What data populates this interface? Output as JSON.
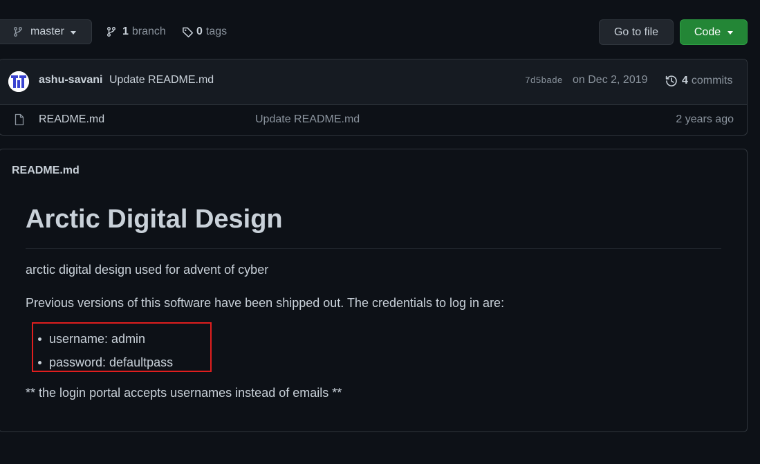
{
  "branch_selector": {
    "label": "master"
  },
  "branches": {
    "count": "1",
    "label": "branch"
  },
  "tags": {
    "count": "0",
    "label": "tags"
  },
  "go_to_file": {
    "label": "Go to file"
  },
  "code_button": {
    "label": "Code"
  },
  "latest_commit": {
    "author": "ashu-savani",
    "message": "Update README.md",
    "sha": "7d5bade",
    "date": "on Dec 2, 2019",
    "commit_count": "4",
    "commit_label": "commits"
  },
  "files": [
    {
      "name": "README.md",
      "last_commit": "Update README.md",
      "age": "2 years ago",
      "icon": "file-icon"
    }
  ],
  "readme": {
    "filename": "README.md",
    "heading": "Arctic Digital Design",
    "paragraph1": "arctic digital design used for advent of cyber",
    "paragraph2": "Previous versions of this software have been shipped out. The credentials to log in are:",
    "credentials": [
      "username: admin",
      "password: defaultpass"
    ],
    "paragraph3": "** the login portal accepts usernames instead of emails **"
  },
  "colors": {
    "background": "#0d1117",
    "code_button": "#238636",
    "highlight_box": "#e01e1e"
  }
}
